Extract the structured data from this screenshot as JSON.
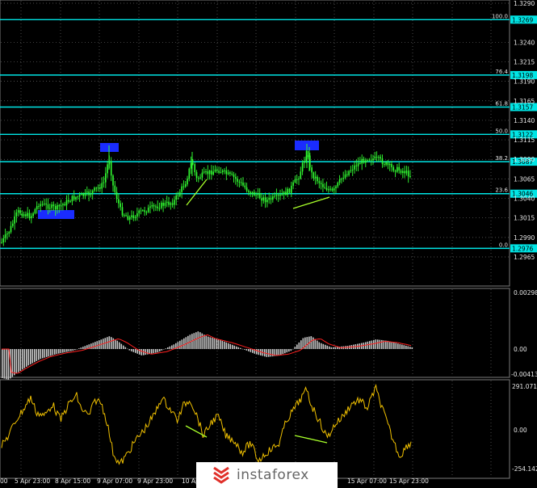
{
  "price_axis": {
    "labels": [
      "1.3290",
      "1.3240",
      "1.3215",
      "1.3190",
      "1.3165",
      "1.3140",
      "1.3115",
      "1.3090",
      "1.3065",
      "1.3040",
      "1.3015",
      "1.2990",
      "1.2965"
    ]
  },
  "fib_levels": [
    {
      "ratio": "100.0",
      "price": "1.3269"
    },
    {
      "ratio": "76.4",
      "price": "1.3198"
    },
    {
      "ratio": "61.8",
      "price": "1.3157"
    },
    {
      "ratio": "50.0",
      "price": "1.3122"
    },
    {
      "ratio": "38.2",
      "price": "1.3087"
    },
    {
      "ratio": "23.6",
      "price": "1.3046"
    },
    {
      "ratio": "0.0",
      "price": "1.2976"
    }
  ],
  "macd": {
    "top": "0.00298",
    "mid": "0.00",
    "bottom": "-0.00413"
  },
  "cci": {
    "top": "291.0717",
    "mid": "0.00",
    "bottom": "-254.142"
  },
  "time_axis": [
    "00",
    "5 Apr 23:00",
    "8 Apr 15:00",
    "9 Apr 07:00",
    "9 Apr 23:00",
    "10 Apr",
    "15 Apr 07:00",
    "15 Apr 23:00"
  ],
  "watermark": {
    "text": "instaforex"
  },
  "colors": {
    "fib": "#00e5e5",
    "candle": "#32ff32",
    "macd_signal": "#ff2020",
    "histogram": "#c8c8c8",
    "cci": "#f0c000",
    "divergence": "#a8ff2a",
    "highlight": "#1a2cff"
  }
}
